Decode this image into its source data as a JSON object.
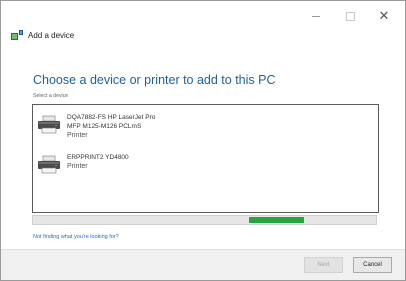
{
  "window": {
    "title": "Add a device",
    "controls": {
      "minimize": "–",
      "maximize": "",
      "close": "✕"
    }
  },
  "main": {
    "title": "Choose a device or printer to add to this PC",
    "subtitle": "Select a device"
  },
  "devices": [
    {
      "name": "DQA7882-FS  HP LaserJet Pro\nMFP M125-M126 PCLmS",
      "type": "Printer",
      "icon": "printer-icon"
    },
    {
      "name": "ERPPRINT2   YD4800",
      "type": "Printer",
      "icon": "printer-icon"
    }
  ],
  "progress": {
    "indeterminate": true,
    "chunk_start_fraction": 0.63,
    "chunk_width_fraction": 0.16,
    "color": "#24a73c"
  },
  "help_link": "Not finding what you're looking for?",
  "footer": {
    "next_label": "Next",
    "cancel_label": "Cancel"
  },
  "colors": {
    "title": "#1f5f9e",
    "link": "#1f6fc0",
    "accent": "#24a73c"
  }
}
